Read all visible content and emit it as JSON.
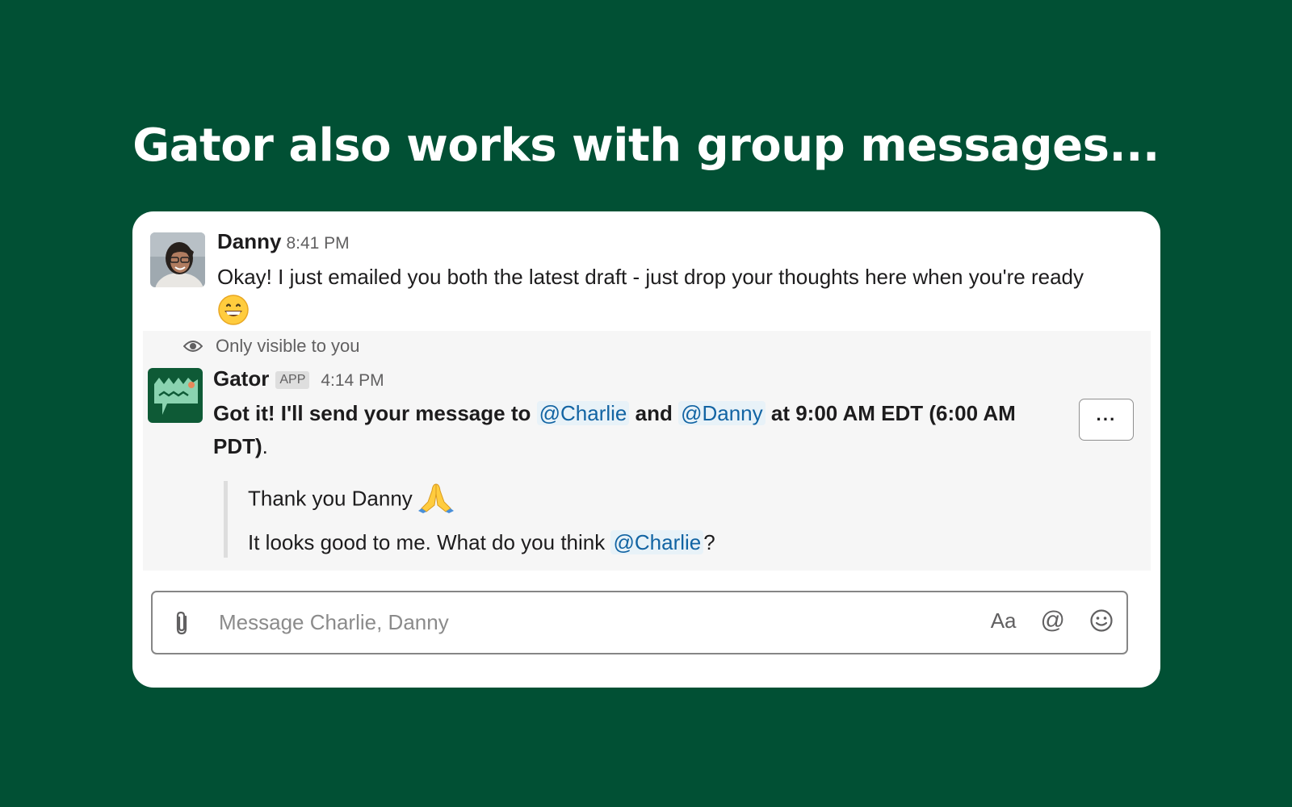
{
  "headline": "Gator also works with group messages...",
  "messages": {
    "danny": {
      "sender": "Danny",
      "time": "8:41 PM",
      "text": "Okay! I just emailed you both the latest draft - just drop your thoughts here when you're ready",
      "emoji": "grinning-face"
    },
    "gator": {
      "visibility_note": "Only visible to you",
      "sender": "Gator",
      "badge": "APP",
      "time": "4:14 PM",
      "text_part1": "Got it! I'll send your message to",
      "mention1": "@Charlie",
      "text_part2": "and",
      "mention2": "@Danny",
      "text_part3": "at 9:00 AM EDT (6:00 AM PDT)",
      "text_end": ".",
      "more_label": "···",
      "quote": {
        "line1": "Thank you Danny",
        "line1_emoji": "folded-hands",
        "line2_part1": "It looks good to me. What do you think",
        "line2_mention": "@Charlie",
        "line2_end": "?"
      }
    }
  },
  "composer": {
    "placeholder": "Message Charlie, Danny",
    "format_label": "Aa",
    "mention_label": "@"
  },
  "colors": {
    "background": "#015034",
    "mention_text": "#1264a3",
    "mention_bg": "#e8f2f8",
    "gator_brand": "#0e5a36"
  }
}
